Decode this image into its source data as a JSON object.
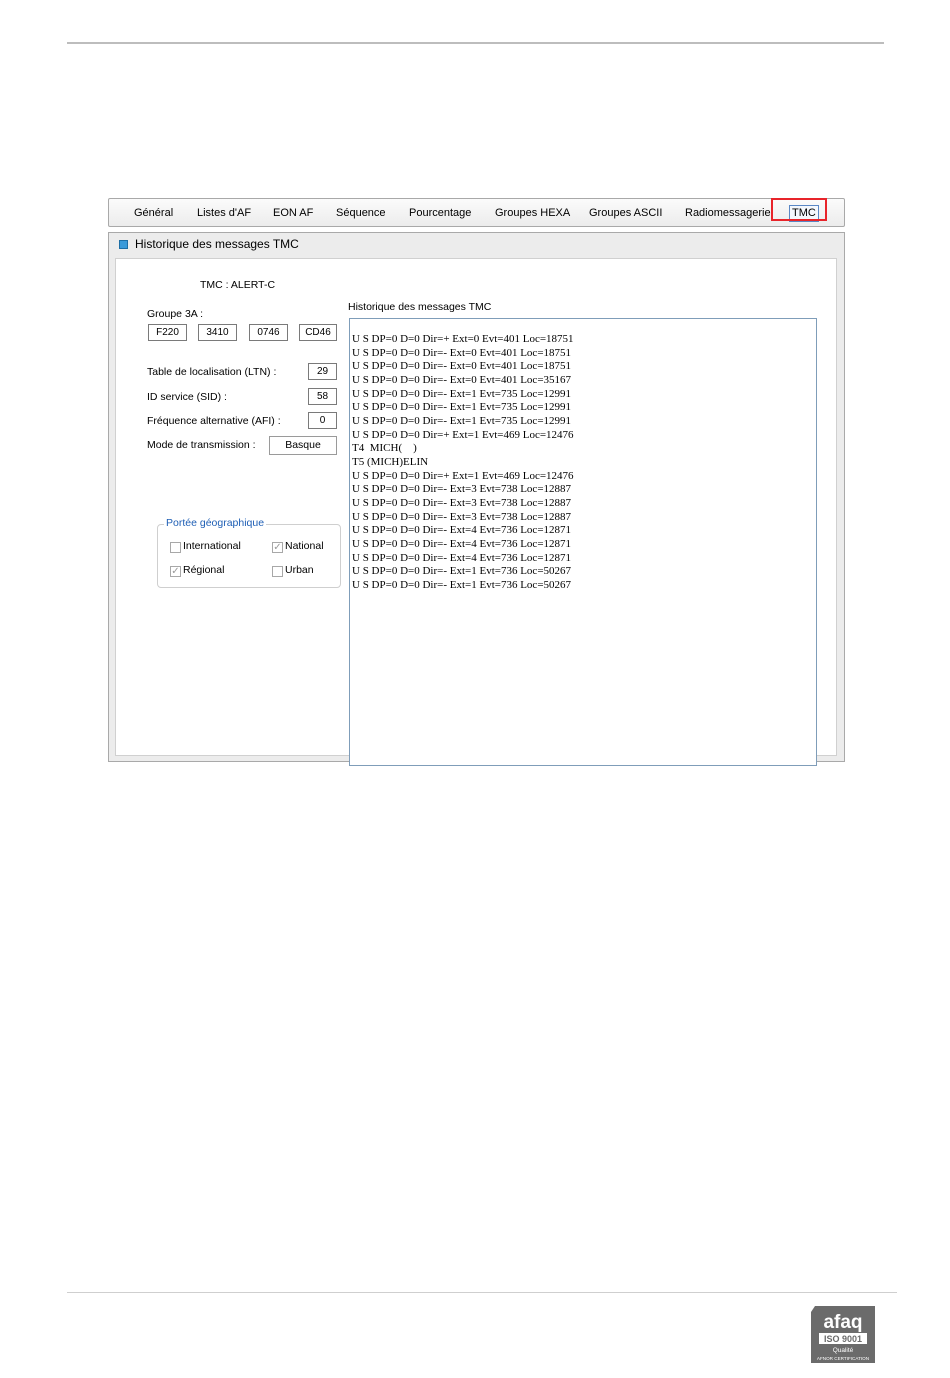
{
  "tabs": [
    {
      "label": "Général"
    },
    {
      "label": "Listes d'AF"
    },
    {
      "label": "EON AF"
    },
    {
      "label": "Séquence"
    },
    {
      "label": "Pourcentage"
    },
    {
      "label": "Groupes HEXA"
    },
    {
      "label": "Groupes ASCII"
    },
    {
      "label": "Radiomessagerie"
    },
    {
      "label": "TMC"
    }
  ],
  "active_tab": "TMC",
  "panel": {
    "title": "Historique des messages TMC"
  },
  "tmc": {
    "title": "TMC : ALERT-C",
    "groupe3a_label": "Groupe 3A :",
    "groupe3a_values": [
      "F220",
      "3410",
      "0746",
      "CD46"
    ],
    "ltn_label": "Table de localisation (LTN) :",
    "ltn_value": "29",
    "sid_label": "ID service (SID) :",
    "sid_value": "58",
    "afi_label": "Fréquence alternative (AFI) :",
    "afi_value": "0",
    "mode_label": "Mode de transmission :",
    "mode_value": "Basque"
  },
  "portee": {
    "legend": "Portée géographique",
    "options": [
      {
        "label": "International",
        "checked": false
      },
      {
        "label": "National",
        "checked": true
      },
      {
        "label": "Régional",
        "checked": true
      },
      {
        "label": "Urban",
        "checked": false
      }
    ]
  },
  "history": {
    "label": "Historique des messages TMC",
    "lines": [
      "U S DP=0 D=0 Dir=+ Ext=0 Evt=401 Loc=18751",
      "U S DP=0 D=0 Dir=- Ext=0 Evt=401 Loc=18751",
      "U S DP=0 D=0 Dir=- Ext=0 Evt=401 Loc=18751",
      "U S DP=0 D=0 Dir=- Ext=0 Evt=401 Loc=35167",
      "U S DP=0 D=0 Dir=- Ext=1 Evt=735 Loc=12991",
      "U S DP=0 D=0 Dir=- Ext=1 Evt=735 Loc=12991",
      "U S DP=0 D=0 Dir=- Ext=1 Evt=735 Loc=12991",
      "U S DP=0 D=0 Dir=+ Ext=1 Evt=469 Loc=12476",
      "T4  MICH(    )",
      "T5 (MICH)ELIN",
      "U S DP=0 D=0 Dir=+ Ext=1 Evt=469 Loc=12476",
      "U S DP=0 D=0 Dir=- Ext=3 Evt=738 Loc=12887",
      "U S DP=0 D=0 Dir=- Ext=3 Evt=738 Loc=12887",
      "U S DP=0 D=0 Dir=- Ext=3 Evt=738 Loc=12887",
      "U S DP=0 D=0 Dir=- Ext=4 Evt=736 Loc=12871",
      "U S DP=0 D=0 Dir=- Ext=4 Evt=736 Loc=12871",
      "U S DP=0 D=0 Dir=- Ext=4 Evt=736 Loc=12871",
      "U S DP=0 D=0 Dir=- Ext=1 Evt=736 Loc=50267",
      "U S DP=0 D=0 Dir=- Ext=1 Evt=736 Loc=50267"
    ]
  },
  "logo": {
    "brand": "afaq",
    "iso": "ISO 9001",
    "quality": "Qualité",
    "cert": "AFNOR CERTIFICATION"
  },
  "colors": {
    "highlight": "#e8242a",
    "accent": "#3a9ad9",
    "legend": "#1f5fb5"
  }
}
